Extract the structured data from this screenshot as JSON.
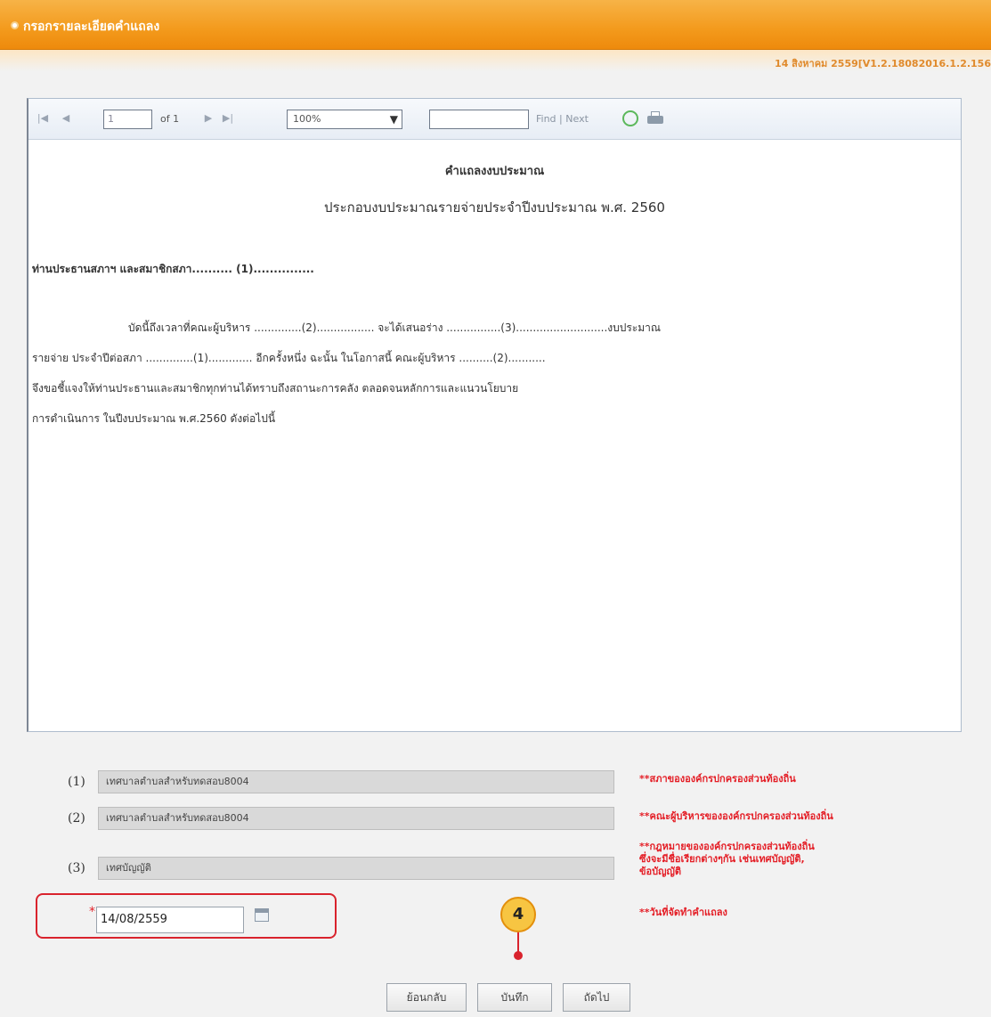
{
  "header": {
    "title": "กรอกรายละเอียดคำแถลง"
  },
  "subheader": {
    "date_version": "14 สิงหาคม 2559[V1.2.18082016.1.2.156"
  },
  "report_toolbar": {
    "page_value": "1",
    "page_of": "of 1",
    "zoom_value": "100%",
    "find_placeholder": "",
    "find_label": "Find",
    "separator": "|",
    "next_label": "Next",
    "icons": [
      "first-page-icon",
      "prev-page-icon",
      "next-page-icon",
      "last-page-icon",
      "refresh-icon",
      "print-icon"
    ]
  },
  "document": {
    "heading": "คำแถลงงบประมาณ",
    "subheading": "ประกอบงบประมาณรายจ่ายประจำปีงบประมาณ พ.ศ. 2560",
    "salutation": "ท่านประธานสภาฯ และสมาชิกสภา.......... (1)...............",
    "p1": "บัดนี้ถึงเวลาที่คณะผู้บริหาร ..............(2)................. จะได้เสนอร่าง ................(3)...........................งบประมาณ",
    "p2": "รายจ่าย ประจำปีต่อสภา ..............(1)............. อีกครั้งหนึ่ง ฉะนั้น ในโอกาสนี้ คณะผู้บริหาร ..........(2)...........",
    "p3": "จึงขอชี้แจงให้ท่านประธานและสมาชิกทุกท่านได้ทราบถึงสถานะการคลัง ตลอดจนหลักการและแนวนโยบาย",
    "p4": "การดำเนินการ ในปีงบประมาณ พ.ศ.2560 ดังต่อไปนี้"
  },
  "fields": [
    {
      "num": "(1)",
      "value": "เทศบาลตำบลสำหรับทดสอบ8004",
      "hint": "**สภาขององค์กรปกครองส่วนท้องถิ่น"
    },
    {
      "num": "(2)",
      "value": "เทศบาลตำบลสำหรับทดสอบ8004",
      "hint": "**คณะผู้บริหารขององค์กรปกครองส่วนท้องถิ่น"
    },
    {
      "num": "(3)",
      "value": "เทศบัญญัติ",
      "hint_line1": "**กฎหมายขององค์กรปกครองส่วนท้องถิ่น",
      "hint_line2": "ซึ่งจะมีชื่อเรียกต่างๆกัน เช่นเทศบัญญัติ,",
      "hint_line3": "ข้อบัญญัติ"
    }
  ],
  "date_field": {
    "required_mark": "*",
    "value": "14/08/2559",
    "hint": "**วันที่จัดทำคำแถลง"
  },
  "step_marker": {
    "number": "4"
  },
  "buttons": {
    "back": "ย้อนกลับ",
    "save": "บันทึก",
    "next": "ถัดไป"
  },
  "colors": {
    "header_orange": "#f39a1c",
    "hint_red": "#e41e26",
    "highlight_red": "#d9232d",
    "step_badge": "#f7c542"
  }
}
